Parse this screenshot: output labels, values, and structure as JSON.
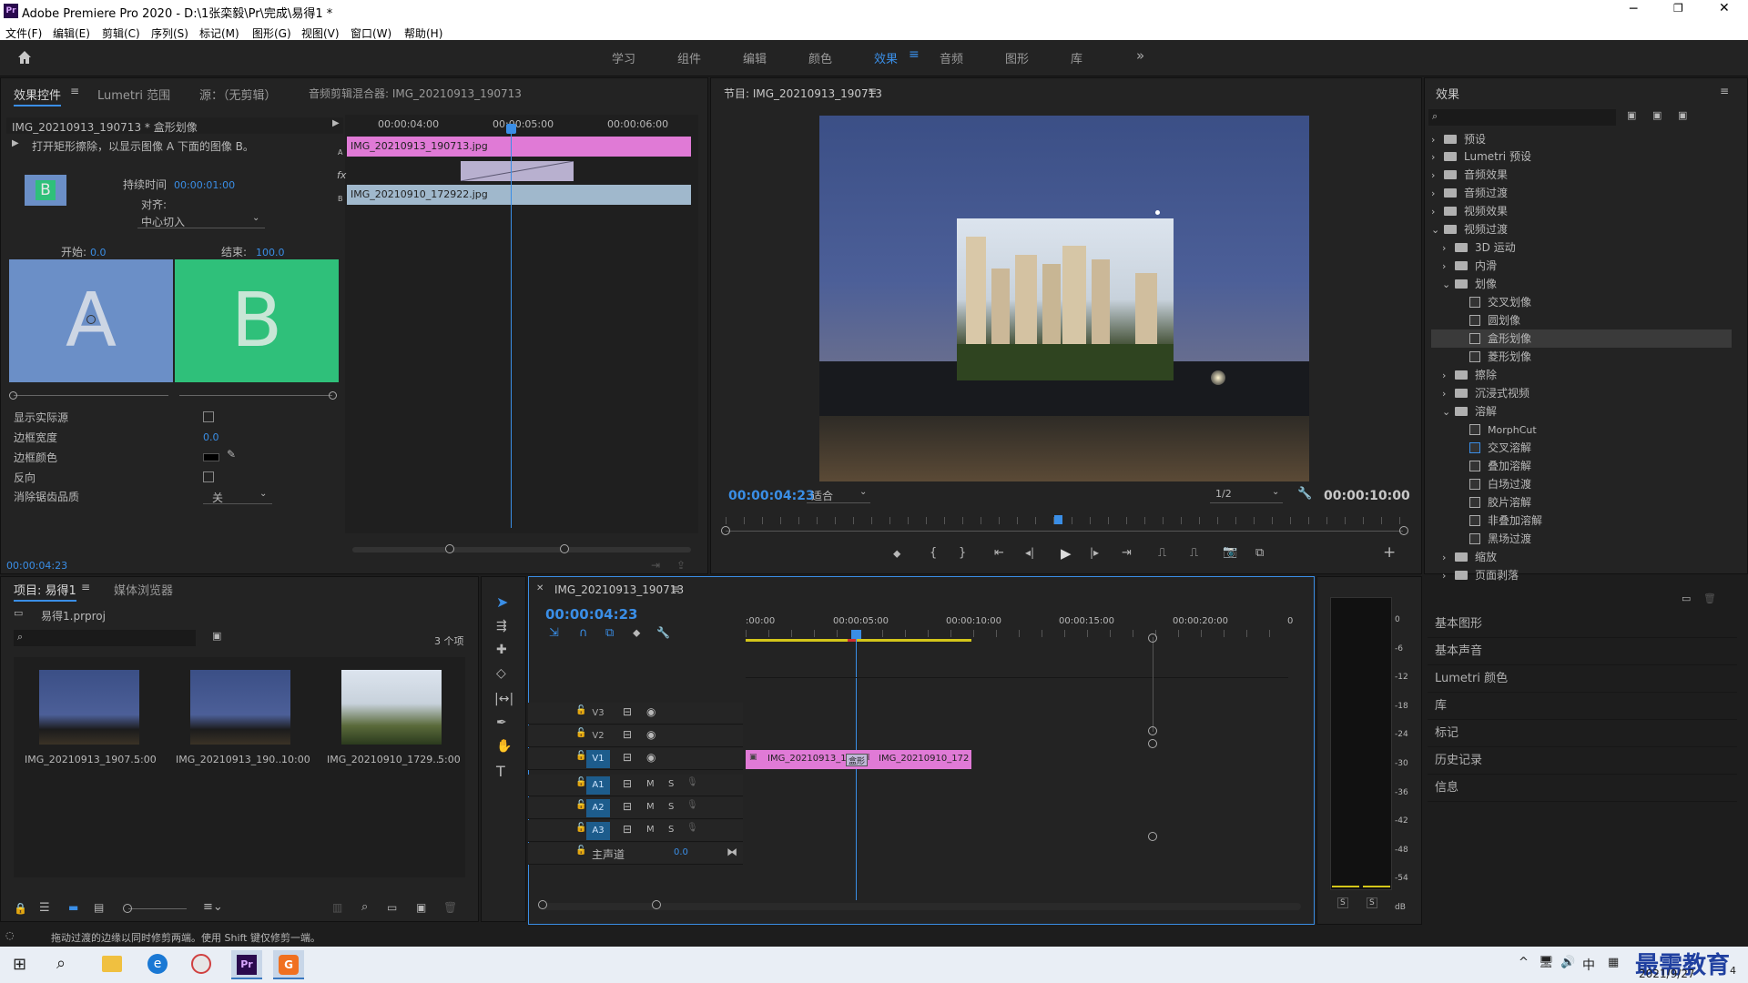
{
  "window": {
    "title": "Adobe Premiere Pro 2020 - D:\\1张栾毅\\Pr\\完成\\易得1 *",
    "logo_text": "Pr"
  },
  "menu": [
    "文件(F)",
    "编辑(E)",
    "剪辑(C)",
    "序列(S)",
    "标记(M)",
    "图形(G)",
    "视图(V)",
    "窗口(W)",
    "帮助(H)"
  ],
  "workspaces": [
    "学习",
    "组件",
    "编辑",
    "颜色",
    "效果",
    "音频",
    "图形",
    "库"
  ],
  "workspace_active": "效果",
  "effect_controls": {
    "tabs": [
      "效果控件",
      "Lumetri 范围",
      "源：（无剪辑）",
      "音频剪辑混合器: IMG_20210913_190713"
    ],
    "clip_label": "IMG_20210913_190713 * 盒形划像",
    "description": "打开矩形擦除，以显示图像 A 下面的图像 B。",
    "duration_label": "持续时间",
    "duration_value": "00:00:01:00",
    "align_label": "对齐:",
    "align_value": "中心切入",
    "start_label": "开始:",
    "start_value": "0.0",
    "end_label": "结束:",
    "end_value": "100.0",
    "preview_a": "A",
    "preview_b": "B",
    "thumb_b": "B",
    "mini_times": [
      "00:00:04:00",
      "00:00:05:00",
      "00:00:06:00"
    ],
    "mini_clip_a": "IMG_20210913_190713.jpg",
    "mini_clip_b": "IMG_20210910_172922.jpg",
    "mini_track_a": "A",
    "mini_track_b": "B",
    "fx": "fx",
    "props": [
      {
        "label": "显示实际源"
      },
      {
        "label": "边框宽度",
        "value": "0.0"
      },
      {
        "label": "边框颜色"
      },
      {
        "label": "反向"
      },
      {
        "label": "消除锯齿品质",
        "value": "关"
      }
    ],
    "timecode": "00:00:04:23"
  },
  "program": {
    "title": "节目: IMG_20210913_190713",
    "timecode": "00:00:04:23",
    "fit": "适合",
    "resolution": "1/2",
    "duration": "00:00:10:00",
    "playhead_fraction": 0.5
  },
  "effects_panel": {
    "title": "效果",
    "tree": [
      {
        "label": "预设",
        "level": 0,
        "type": "folder",
        "arrow": "›"
      },
      {
        "label": "Lumetri 预设",
        "level": 0,
        "type": "folder",
        "arrow": "›"
      },
      {
        "label": "音频效果",
        "level": 0,
        "type": "folder",
        "arrow": "›"
      },
      {
        "label": "音频过渡",
        "level": 0,
        "type": "folder",
        "arrow": "›"
      },
      {
        "label": "视频效果",
        "level": 0,
        "type": "folder",
        "arrow": "›"
      },
      {
        "label": "视频过渡",
        "level": 0,
        "type": "folder",
        "arrow": "⌄"
      },
      {
        "label": "3D 运动",
        "level": 1,
        "type": "folder",
        "arrow": "›"
      },
      {
        "label": "内滑",
        "level": 1,
        "type": "folder",
        "arrow": "›"
      },
      {
        "label": "划像",
        "level": 1,
        "type": "folder",
        "arrow": "⌄"
      },
      {
        "label": "交叉划像",
        "level": 2,
        "type": "fx"
      },
      {
        "label": "圆划像",
        "level": 2,
        "type": "fx"
      },
      {
        "label": "盒形划像",
        "level": 2,
        "type": "fx",
        "selected": true
      },
      {
        "label": "菱形划像",
        "level": 2,
        "type": "fx"
      },
      {
        "label": "擦除",
        "level": 1,
        "type": "folder",
        "arrow": "›"
      },
      {
        "label": "沉浸式视频",
        "level": 1,
        "type": "folder",
        "arrow": "›"
      },
      {
        "label": "溶解",
        "level": 1,
        "type": "folder",
        "arrow": "⌄"
      },
      {
        "label": "MorphCut",
        "level": 2,
        "type": "fx"
      },
      {
        "label": "交叉溶解",
        "level": 2,
        "type": "fx",
        "blue": true
      },
      {
        "label": "叠加溶解",
        "level": 2,
        "type": "fx"
      },
      {
        "label": "白场过渡",
        "level": 2,
        "type": "fx"
      },
      {
        "label": "胶片溶解",
        "level": 2,
        "type": "fx"
      },
      {
        "label": "非叠加溶解",
        "level": 2,
        "type": "fx"
      },
      {
        "label": "黑场过渡",
        "level": 2,
        "type": "fx"
      },
      {
        "label": "缩放",
        "level": 1,
        "type": "folder",
        "arrow": "›"
      },
      {
        "label": "页面剥落",
        "level": 1,
        "type": "folder",
        "arrow": "›"
      }
    ],
    "collapsed_panels": [
      "基本图形",
      "基本声音",
      "Lumetri 颜色",
      "库",
      "标记",
      "历史记录",
      "信息"
    ]
  },
  "project": {
    "tabs": [
      "项目: 易得1",
      "媒体浏览器"
    ],
    "file": "易得1.prproj",
    "count": "3 个项",
    "items": [
      {
        "name": "IMG_20210913_1907...",
        "duration": "5:00"
      },
      {
        "name": "IMG_20210913_190...",
        "duration": "10:00"
      },
      {
        "name": "IMG_20210910_1729...",
        "duration": "5:00"
      }
    ]
  },
  "timeline": {
    "tab": "IMG_20210913_190713",
    "timecode": "00:00:04:23",
    "ruler": [
      ":00:00",
      "00:00:05:00",
      "00:00:10:00",
      "00:00:15:00",
      "00:00:20:00",
      "0"
    ],
    "tracks": [
      "V3",
      "V2",
      "V1",
      "A1",
      "A2",
      "A3"
    ],
    "master": "主声道",
    "master_value": "0.0",
    "clip1": "IMG_20210913_19",
    "clip2": "IMG_20210910_172",
    "transition_label": "盒形",
    "m": "M",
    "s": "S"
  },
  "meters": {
    "scale": [
      "0",
      "-6",
      "-12",
      "-18",
      "-24",
      "-30",
      "-36",
      "-42",
      "-48",
      "-54",
      "dB"
    ],
    "solo": [
      "S",
      "S"
    ]
  },
  "status": "拖动过渡的边缘以同时修剪两端。使用 Shift 键仅修剪一端。",
  "taskbar": {
    "ime": "中",
    "date": "2021/9/27",
    "watermark": "最需教育",
    "watermark_num": "4"
  }
}
